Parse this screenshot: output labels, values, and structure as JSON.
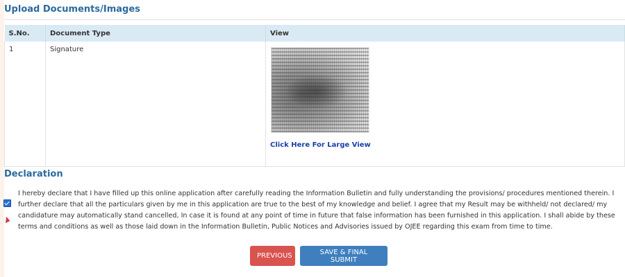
{
  "upload": {
    "title": "Upload Documents/Images",
    "columns": [
      "S.No.",
      "Document Type",
      "View"
    ],
    "rows": [
      {
        "sno": "1",
        "type": "Signature",
        "view_link": "Click Here For Large View"
      }
    ]
  },
  "declaration": {
    "title": "Declaration",
    "checked": true,
    "text": "I hereby declare that I have filled up this online application after carefully reading the Information Bulletin and fully understanding the provisions/ procedures mentioned therein. I further declare that all the particulars given by me in this application are true to the best of my knowledge and belief. I agree that my Result may be withheld/ not declared/ my candidature may automatically stand cancelled, In case it is found at any point of time in future that false information has been furnished in this application. I shall abide by these terms and conditions as well as those laid down in the Information Bulletin, Public Notices and Advisories issued by OJEE regarding this exam from time to time."
  },
  "buttons": {
    "previous": "PREVIOUS",
    "submit": "SAVE & FINAL SUBMIT"
  },
  "colors": {
    "heading": "#2b6a9e",
    "table_header_bg": "#d9eaf4",
    "previous_bg": "#d9534f",
    "submit_bg": "#3f7fbe",
    "page_bg": "#fdf3ea"
  }
}
